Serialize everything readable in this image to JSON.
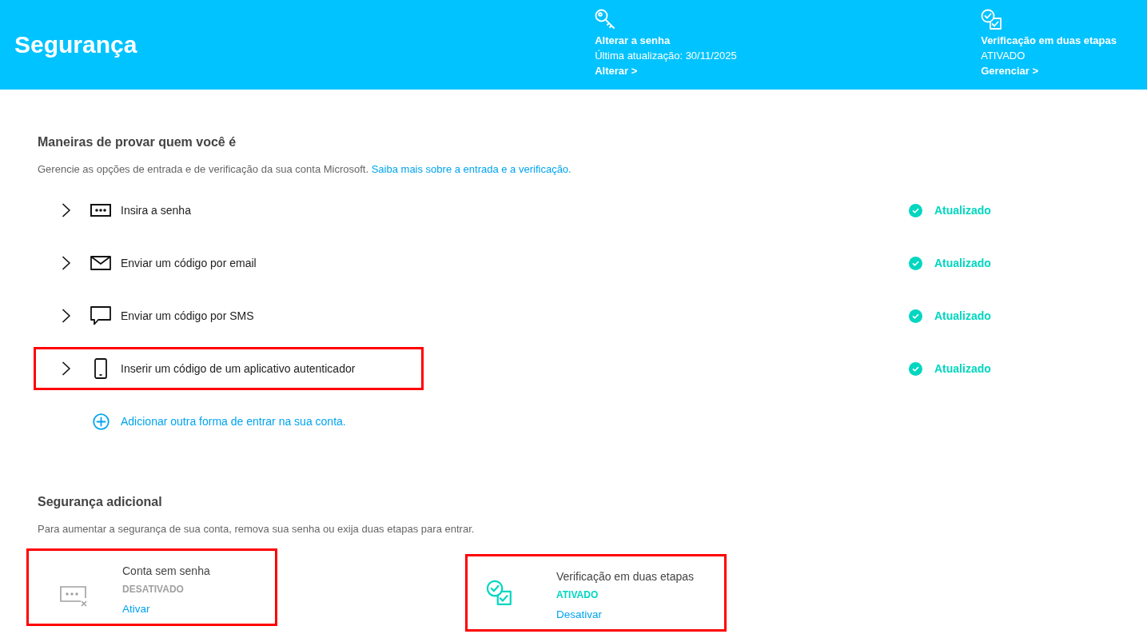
{
  "header": {
    "title": "Segurança",
    "items": [
      {
        "kind": "password",
        "title": "Alterar a senha",
        "detail": "Última atualização: 30/11/2025",
        "action": "Alterar >"
      },
      {
        "kind": "two-step",
        "title": "Verificação em duas etapas",
        "detail": "ATIVADO",
        "action": "Gerenciar >"
      }
    ]
  },
  "methods": {
    "heading": "Maneiras de provar quem você é",
    "description": "Gerencie as opções de entrada e de verificação da sua conta Microsoft.",
    "link": "Saiba mais sobre a entrada e a verificação.",
    "items": [
      {
        "kind": "password",
        "label": "Insira a senha",
        "status": "Atualizado",
        "highlighted": false
      },
      {
        "kind": "email",
        "label": "Enviar um código por email",
        "status": "Atualizado",
        "highlighted": false
      },
      {
        "kind": "sms",
        "label": "Enviar um código por SMS",
        "status": "Atualizado",
        "highlighted": false
      },
      {
        "kind": "app",
        "label": "Inserir um código de um aplicativo autenticador",
        "status": "Atualizado",
        "highlighted": true
      }
    ],
    "add_link": "Adicionar outra forma de entrar na sua conta."
  },
  "additional": {
    "heading": "Segurança adicional",
    "description": "Para aumentar a segurança de sua conta, remova sua senha ou exija duas etapas para entrar.",
    "cards": [
      {
        "kind": "passwordless",
        "title": "Conta sem senha",
        "status": "DESATIVADO",
        "on": false,
        "action": "Ativar",
        "highlighted": true
      },
      {
        "kind": "two-step",
        "title": "Verificação em duas etapas",
        "status": "ATIVADO",
        "on": true,
        "action": "Desativar",
        "highlighted": true
      }
    ]
  }
}
